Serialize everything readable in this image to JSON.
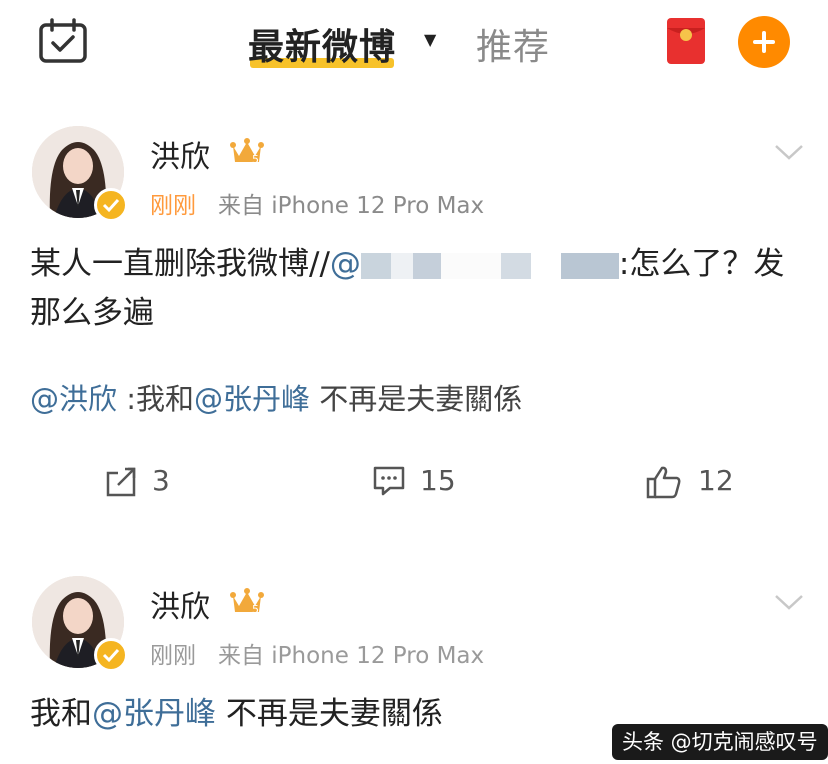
{
  "header": {
    "tab_latest": "最新微博",
    "tab_recommend": "推荐",
    "icons": [
      "calendar-check-icon",
      "red-packet-icon",
      "plus-icon"
    ],
    "accent": "#f7c22a",
    "plus_color": "#ff8a00"
  },
  "posts": [
    {
      "author": "洪欣",
      "time": "刚刚",
      "source": "来自 iPhone 12 Pro Max",
      "text_part1": "某人一直删除我微博//",
      "text_mention_blur": "@",
      "text_part2": ":怎么了？发",
      "text_line2": "那么多遍",
      "repost_mention": "@洪欣",
      "repost_sep": " :我和",
      "repost_mention2": "@张丹峰",
      "repost_tail": " 不再是夫妻關係",
      "actions": {
        "share": "3",
        "comment": "15",
        "like": "12"
      }
    },
    {
      "author": "洪欣",
      "time": "刚刚",
      "source": "来自 iPhone 12 Pro Max",
      "text_part1": "我和",
      "text_mention": "@张丹峰",
      "text_part2": " 不再是夫妻關係"
    }
  ],
  "watermark": "头条 @切克闹感叹号",
  "colors": {
    "mention": "#3f6e98",
    "time": "#ff9a3c",
    "meta": "#8b8b8b",
    "verified": "#f5b521"
  }
}
